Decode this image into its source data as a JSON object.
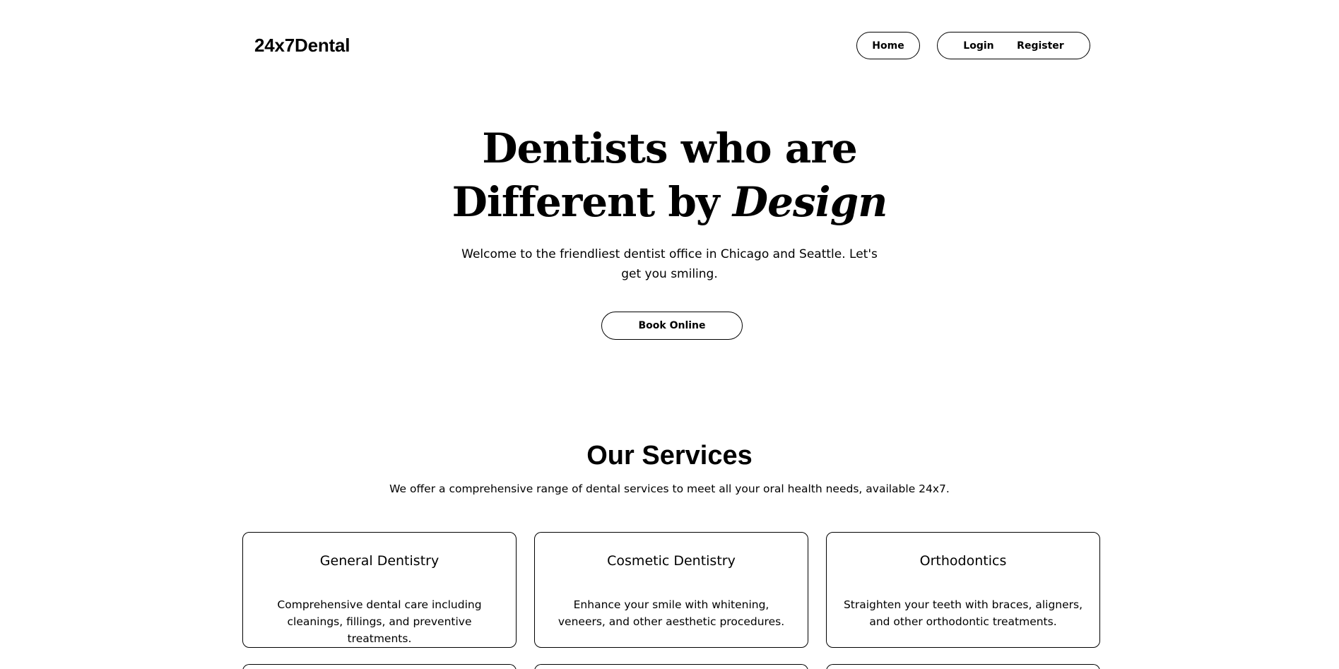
{
  "header": {
    "logo": "24x7Dental",
    "nav": {
      "home": "Home",
      "login": "Login",
      "register": "Register"
    }
  },
  "hero": {
    "title_line1": "Dentists who are",
    "title_line2": "Different by ",
    "title_emphasis": "Design",
    "subtitle": "Welcome to the friendliest dentist office in Chicago and Seattle. Let's get you smiling.",
    "cta": "Book Online"
  },
  "services": {
    "title": "Our Services",
    "subtitle": "We offer a comprehensive range of dental services to meet all your oral health needs, available 24x7.",
    "cards": [
      {
        "title": "General Dentistry",
        "description": "Comprehensive dental care including cleanings, fillings, and preventive treatments."
      },
      {
        "title": "Cosmetic Dentistry",
        "description": "Enhance your smile with whitening, veneers, and other aesthetic procedures."
      },
      {
        "title": "Orthodontics",
        "description": "Straighten your teeth with braces, aligners, and other orthodontic treatments."
      }
    ]
  },
  "colors": {
    "background": "#ffffff",
    "text": "#000000",
    "border": "#000000"
  }
}
